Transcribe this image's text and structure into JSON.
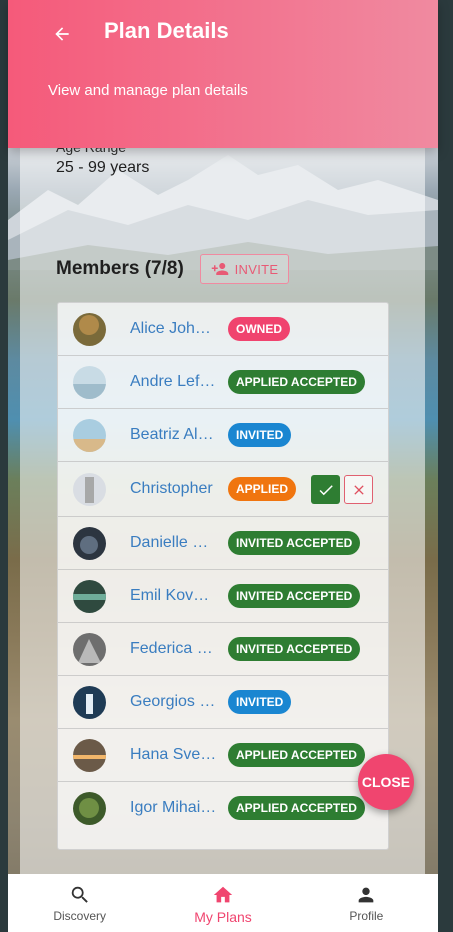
{
  "header": {
    "title": "Plan Details",
    "subtitle": "View and manage plan details"
  },
  "age": {
    "label": "Age Range",
    "value": "25 - 99 years"
  },
  "members": {
    "title": "Members (7/8)",
    "invite_label": "INVITE",
    "items": [
      {
        "name": "Alice Johnson",
        "status": "OWNED"
      },
      {
        "name": "Andre Lefevre",
        "status": "APPLIED ACCEPTED"
      },
      {
        "name": "Beatriz Alves",
        "status": "INVITED"
      },
      {
        "name": "Christopher",
        "status": "APPLIED"
      },
      {
        "name": "Danielle Moreau",
        "status": "INVITED ACCEPTED"
      },
      {
        "name": "Emil Kovacs",
        "status": "INVITED ACCEPTED"
      },
      {
        "name": "Federica Rossi",
        "status": "INVITED ACCEPTED"
      },
      {
        "name": "Georgios Papadopoulos",
        "status": "INVITED"
      },
      {
        "name": "Hana Svensson",
        "status": "APPLIED ACCEPTED"
      },
      {
        "name": "Igor Mihailov",
        "status": "APPLIED ACCEPTED"
      }
    ]
  },
  "close_label": "CLOSE",
  "nav": {
    "discovery": "Discovery",
    "my_plans": "My Plans",
    "profile": "Profile"
  },
  "colors": {
    "accent": "#f0456f",
    "owned": "#f0436e",
    "accepted": "#2e7d32",
    "invited": "#1a86d1",
    "applied": "#f0750f",
    "link": "#3a7dc0"
  }
}
